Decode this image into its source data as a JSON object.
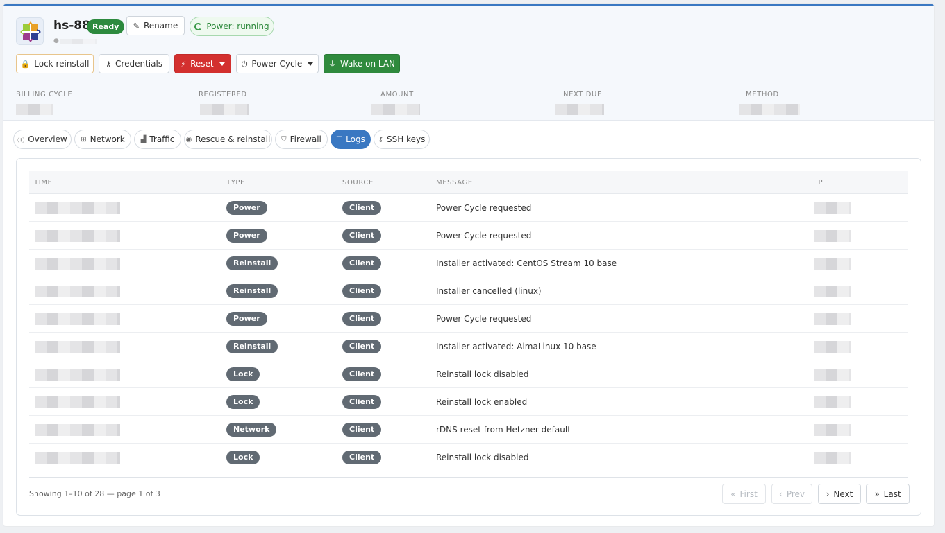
{
  "server": {
    "name": "hs-88",
    "status": "Ready",
    "rename_label": "Rename",
    "power_label": "Power: running"
  },
  "actions": {
    "lock_reinstall": "Lock reinstall",
    "credentials": "Credentials",
    "reset": "Reset",
    "power_cycle": "Power Cycle",
    "wake_on_lan": "Wake on LAN"
  },
  "billing": {
    "labels": [
      "BILLING CYCLE",
      "REGISTERED",
      "AMOUNT",
      "NEXT DUE",
      "METHOD"
    ]
  },
  "tabs": [
    "Overview",
    "Network",
    "Traffic",
    "Rescue & reinstall",
    "Firewall",
    "Logs",
    "SSH keys"
  ],
  "active_tab": "Logs",
  "logs": {
    "columns": [
      "TIME",
      "TYPE",
      "SOURCE",
      "MESSAGE",
      "IP"
    ],
    "rows": [
      {
        "type": "Power",
        "source": "Client",
        "message": "Power Cycle requested"
      },
      {
        "type": "Power",
        "source": "Client",
        "message": "Power Cycle requested"
      },
      {
        "type": "Reinstall",
        "source": "Client",
        "message": "Installer activated: CentOS Stream 10 base"
      },
      {
        "type": "Reinstall",
        "source": "Client",
        "message": "Installer cancelled (linux)"
      },
      {
        "type": "Power",
        "source": "Client",
        "message": "Power Cycle requested"
      },
      {
        "type": "Reinstall",
        "source": "Client",
        "message": "Installer activated: AlmaLinux 10 base"
      },
      {
        "type": "Lock",
        "source": "Client",
        "message": "Reinstall lock disabled"
      },
      {
        "type": "Lock",
        "source": "Client",
        "message": "Reinstall lock enabled"
      },
      {
        "type": "Network",
        "source": "Client",
        "message": "rDNS reset from Hetzner default"
      },
      {
        "type": "Lock",
        "source": "Client",
        "message": "Reinstall lock disabled"
      }
    ],
    "summary": "Showing 1–10 of 28 — page 1 of 3"
  },
  "pagination": {
    "first": "First",
    "prev": "Prev",
    "next": "Next",
    "last": "Last"
  },
  "colors": {
    "accent": "#3a78c2",
    "ready": "#2d8a3e",
    "danger": "#d3302f"
  }
}
